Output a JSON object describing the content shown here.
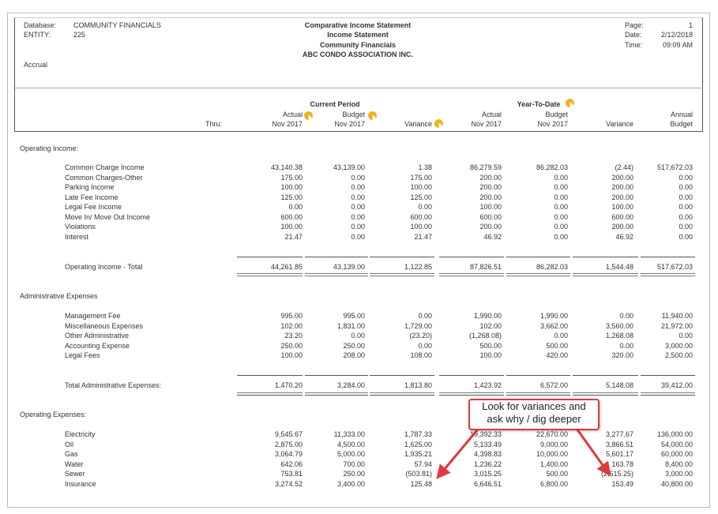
{
  "header": {
    "database_label": "Database:",
    "database_value": "COMMUNITY FINANCIALS",
    "entity_label": "ENTITY:",
    "entity_value": "225",
    "basis": "Accrual",
    "title_lines": [
      "Comparative Income Statement",
      "Income Statement",
      "Community Financials",
      "ABC CONDO ASSOCIATION INC."
    ],
    "page_label": "Page:",
    "page_value": "1",
    "date_label": "Date:",
    "date_value": "2/12/2018",
    "time_label": "Time:",
    "time_value": "09:09 AM"
  },
  "columns": {
    "current_period": "Current Period",
    "year_to_date": "Year-To-Date",
    "thru": "Thru:",
    "headers": [
      [
        "Actual",
        "Nov 2017"
      ],
      [
        "Budget",
        "Nov 2017"
      ],
      [
        "",
        "Variance"
      ],
      [
        "Actual",
        "Nov 2017"
      ],
      [
        "Budget",
        "Nov 2017"
      ],
      [
        "",
        "Variance"
      ],
      [
        "Annual",
        "Budget"
      ]
    ]
  },
  "sections": [
    {
      "title": "Operating Income:",
      "rows": [
        [
          "Common Charge Income",
          "43,140.38",
          "43,139.00",
          "1.38",
          "86,279.59",
          "86,282.03",
          "(2.44)",
          "517,672.03"
        ],
        [
          "Common Charges-Other",
          "175.00",
          "0.00",
          "175.00",
          "200.00",
          "0.00",
          "200.00",
          "0.00"
        ],
        [
          "Parking Income",
          "100.00",
          "0.00",
          "100.00",
          "200.00",
          "0.00",
          "200.00",
          "0.00"
        ],
        [
          "Late Fee Income",
          "125.00",
          "0.00",
          "125.00",
          "200.00",
          "0.00",
          "200.00",
          "0.00"
        ],
        [
          "Legal Fee Income",
          "0.00",
          "0.00",
          "0.00",
          "100.00",
          "0.00",
          "100.00",
          "0.00"
        ],
        [
          "Move In/ Move Out Income",
          "600.00",
          "0.00",
          "600.00",
          "600.00",
          "0.00",
          "600.00",
          "0.00"
        ],
        [
          "Violations",
          "100.00",
          "0.00",
          "100.00",
          "200.00",
          "0.00",
          "200.00",
          "0.00"
        ],
        [
          "Interest",
          "21.47",
          "0.00",
          "21.47",
          "46.92",
          "0.00",
          "46.92",
          "0.00"
        ]
      ],
      "total": [
        "Operating Income - Total",
        "44,261.85",
        "43,139.00",
        "1,122.85",
        "87,826.51",
        "86,282.03",
        "1,544.48",
        "517,672.03"
      ]
    },
    {
      "title": "Administrative Expenses",
      "rows": [
        [
          "Management Fee",
          "995.00",
          "995.00",
          "0.00",
          "1,990.00",
          "1,990.00",
          "0.00",
          "11,940.00"
        ],
        [
          "Miscellaneous Expenses",
          "102.00",
          "1,831.00",
          "1,729.00",
          "102.00",
          "3,662.00",
          "3,560.00",
          "21,972.00"
        ],
        [
          "Other Administrative",
          "23.20",
          "0.00",
          "(23.20)",
          "(1,268.08)",
          "0.00",
          "1,268.08",
          "0.00"
        ],
        [
          "Accounting Expense",
          "250.00",
          "250.00",
          "0.00",
          "500.00",
          "500.00",
          "0.00",
          "3,000.00"
        ],
        [
          "Legal Fees",
          "100.00",
          "208.00",
          "108.00",
          "100.00",
          "420.00",
          "320.00",
          "2,500.00"
        ]
      ],
      "total": [
        "Total Administrative Expenses:",
        "1,470.20",
        "3,284.00",
        "1,813.80",
        "1,423.92",
        "6,572.00",
        "5,148.08",
        "39,412.00"
      ]
    },
    {
      "title": "Operating  Expenses:",
      "rows": [
        [
          "Electricity",
          "9,545.67",
          "11,333.00",
          "1,787.33",
          "19,392.33",
          "22,670.00",
          "3,277.67",
          "136,000.00"
        ],
        [
          "Oil",
          "2,875.00",
          "4,500.00",
          "1,625.00",
          "5,133.49",
          "9,000.00",
          "3,866.51",
          "54,000.00"
        ],
        [
          "Gas",
          "3,064.79",
          "5,000.00",
          "1,935.21",
          "4,398.83",
          "10,000.00",
          "5,601.17",
          "60,000.00"
        ],
        [
          "Water",
          "642.06",
          "700.00",
          "57.94",
          "1,236.22",
          "1,400.00",
          "163.78",
          "8,400.00"
        ],
        [
          "Sewer",
          "753.81",
          "250.00",
          "(503.81)",
          "3,015.25",
          "500.00",
          "(2,515.25)",
          "3,000.00"
        ],
        [
          "Insurance",
          "3,274.52",
          "3,400.00",
          "125.48",
          "6,646.51",
          "6,800.00",
          "153.49",
          "40,800.00"
        ]
      ]
    }
  ],
  "callout": {
    "lines": [
      "Look for variances and",
      "ask why / dig deeper"
    ],
    "border_color": "#e0393e"
  },
  "cursor_marker_color": "#f0b41c"
}
